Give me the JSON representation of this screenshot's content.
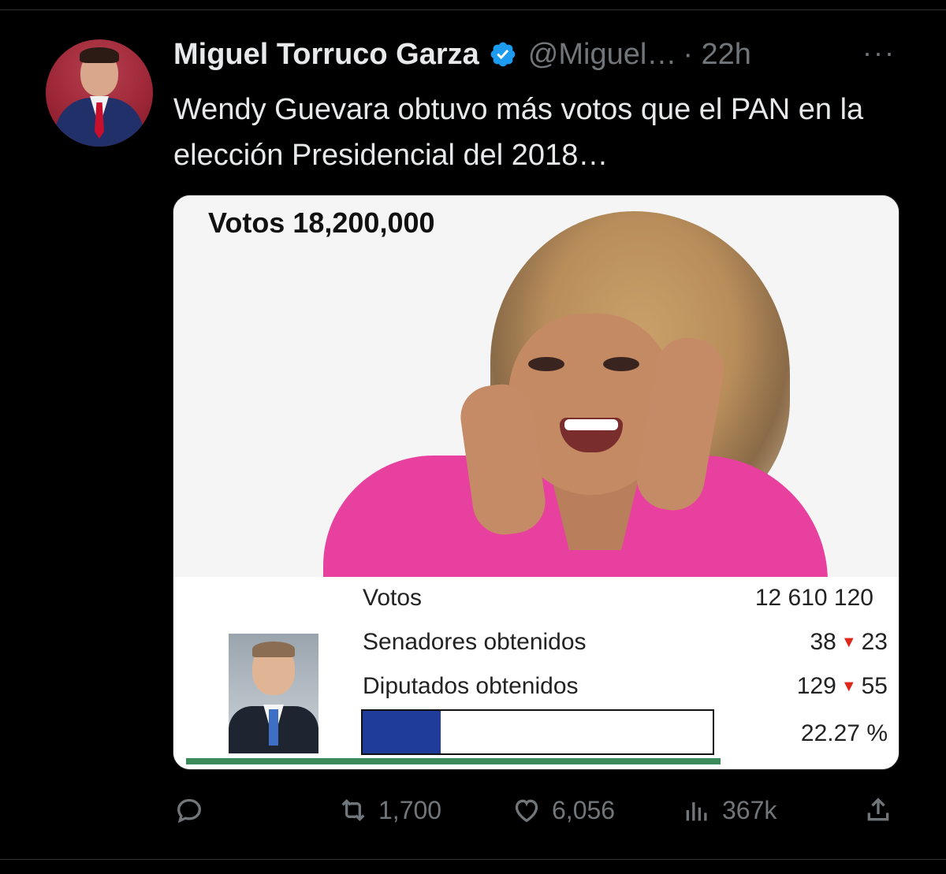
{
  "tweet": {
    "display_name": "Miguel Torruco Garza",
    "handle": "@Miguel…",
    "time": "· 22h",
    "more": "···",
    "text": "Wendy Guevara obtuvo más votos que el PAN en la elección Presidencial del 2018…"
  },
  "media": {
    "title": "Votos 18,200,000",
    "stats": [
      {
        "label": "Votos",
        "value": "12 610 120"
      },
      {
        "label": "Senadores obtenidos",
        "value_before": "38",
        "value_after": "23"
      },
      {
        "label": "Diputados obtenidos",
        "value_before": "129",
        "value_after": "55"
      }
    ],
    "percentage": "22.27 %",
    "progress_fraction": 0.2227,
    "colors": {
      "progress_fill": "#1f3c9a",
      "arrow": "#e0261b",
      "underline": "#3d8b5a",
      "blouse": "#e8409e"
    }
  },
  "actions": {
    "reply_icon": "reply-icon",
    "retweet_count": "1,700",
    "like_count": "6,056",
    "views_count": "367k",
    "share_icon": "share-icon"
  },
  "theme": {
    "background": "#000000",
    "text": "#e7e9ea",
    "muted": "#71767b",
    "verified": "#1d9bf0"
  }
}
